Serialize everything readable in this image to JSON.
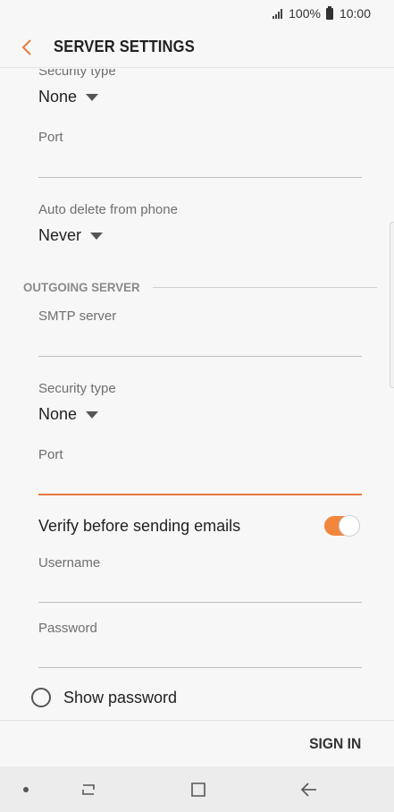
{
  "status_bar": {
    "battery_text": "100%",
    "time": "10:00"
  },
  "app_bar": {
    "title": "SERVER SETTINGS"
  },
  "incoming": {
    "security_type_label": "Security type",
    "security_type_value": "None",
    "port_label": "Port",
    "port_value": "",
    "auto_delete_label": "Auto delete from phone",
    "auto_delete_value": "Never"
  },
  "outgoing": {
    "section_title": "OUTGOING SERVER",
    "smtp_label": "SMTP server",
    "smtp_value": "",
    "security_type_label": "Security type",
    "security_type_value": "None",
    "port_label": "Port",
    "port_value": "",
    "verify_label": "Verify before sending emails",
    "verify_enabled": true,
    "username_label": "Username",
    "username_value": "",
    "password_label": "Password",
    "password_value": "",
    "show_password_label": "Show password",
    "show_password_checked": false
  },
  "actions": {
    "sign_in_label": "SIGN IN"
  },
  "colors": {
    "accent": "#e8773f",
    "toggle_on": "#f0873d",
    "background": "#f7f7f7"
  },
  "icons": {
    "back": "chevron-left-icon",
    "recent_apps": "recent-apps-icon",
    "home": "home-icon",
    "nav_back": "arrow-left-icon"
  }
}
